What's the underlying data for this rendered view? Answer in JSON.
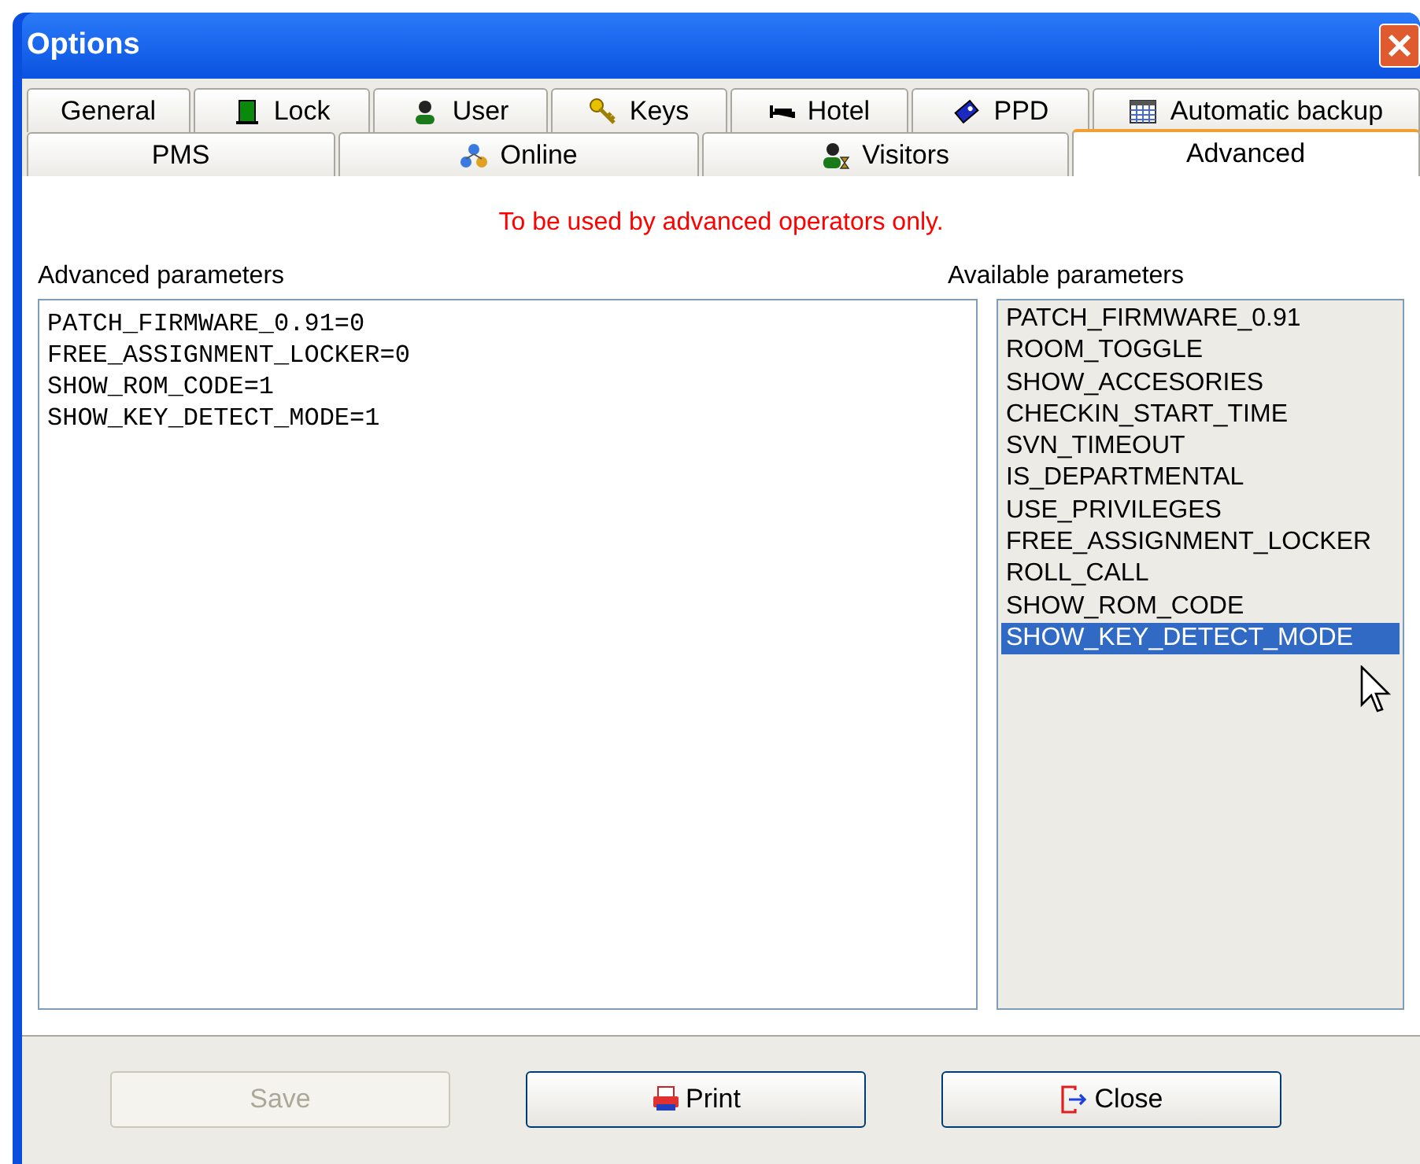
{
  "window": {
    "title": "Options"
  },
  "tab_rows": [
    [
      {
        "label": "General",
        "selected": false
      },
      {
        "label": "Lock",
        "selected": false
      },
      {
        "label": "User",
        "selected": false
      },
      {
        "label": "Keys",
        "selected": false
      },
      {
        "label": "Hotel",
        "selected": false
      },
      {
        "label": "PPD",
        "selected": false
      },
      {
        "label": "Automatic backup",
        "selected": false
      }
    ],
    [
      {
        "label": "PMS",
        "selected": false
      },
      {
        "label": "Online",
        "selected": false
      },
      {
        "label": "Visitors",
        "selected": false
      },
      {
        "label": "Advanced",
        "selected": true
      }
    ]
  ],
  "warning": "To be used by advanced operators only.",
  "advanced_parameters": {
    "label": "Advanced parameters",
    "value": "PATCH_FIRMWARE_0.91=0\nFREE_ASSIGNMENT_LOCKER=0\nSHOW_ROM_CODE=1\nSHOW_KEY_DETECT_MODE=1"
  },
  "available_parameters": {
    "label": "Available parameters",
    "items": [
      {
        "label": "PATCH_FIRMWARE_0.91",
        "selected": false
      },
      {
        "label": "ROOM_TOGGLE",
        "selected": false
      },
      {
        "label": "SHOW_ACCESORIES",
        "selected": false
      },
      {
        "label": "CHECKIN_START_TIME",
        "selected": false
      },
      {
        "label": "SVN_TIMEOUT",
        "selected": false
      },
      {
        "label": "IS_DEPARTMENTAL",
        "selected": false
      },
      {
        "label": "USE_PRIVILEGES",
        "selected": false
      },
      {
        "label": "FREE_ASSIGNMENT_LOCKER",
        "selected": false
      },
      {
        "label": "ROLL_CALL",
        "selected": false
      },
      {
        "label": "SHOW_ROM_CODE",
        "selected": false
      },
      {
        "label": "SHOW_KEY_DETECT_MODE",
        "selected": true
      }
    ]
  },
  "buttons": [
    {
      "label": "Save",
      "disabled": true
    },
    {
      "label": "Print",
      "disabled": false
    },
    {
      "label": "Close",
      "disabled": false
    }
  ]
}
